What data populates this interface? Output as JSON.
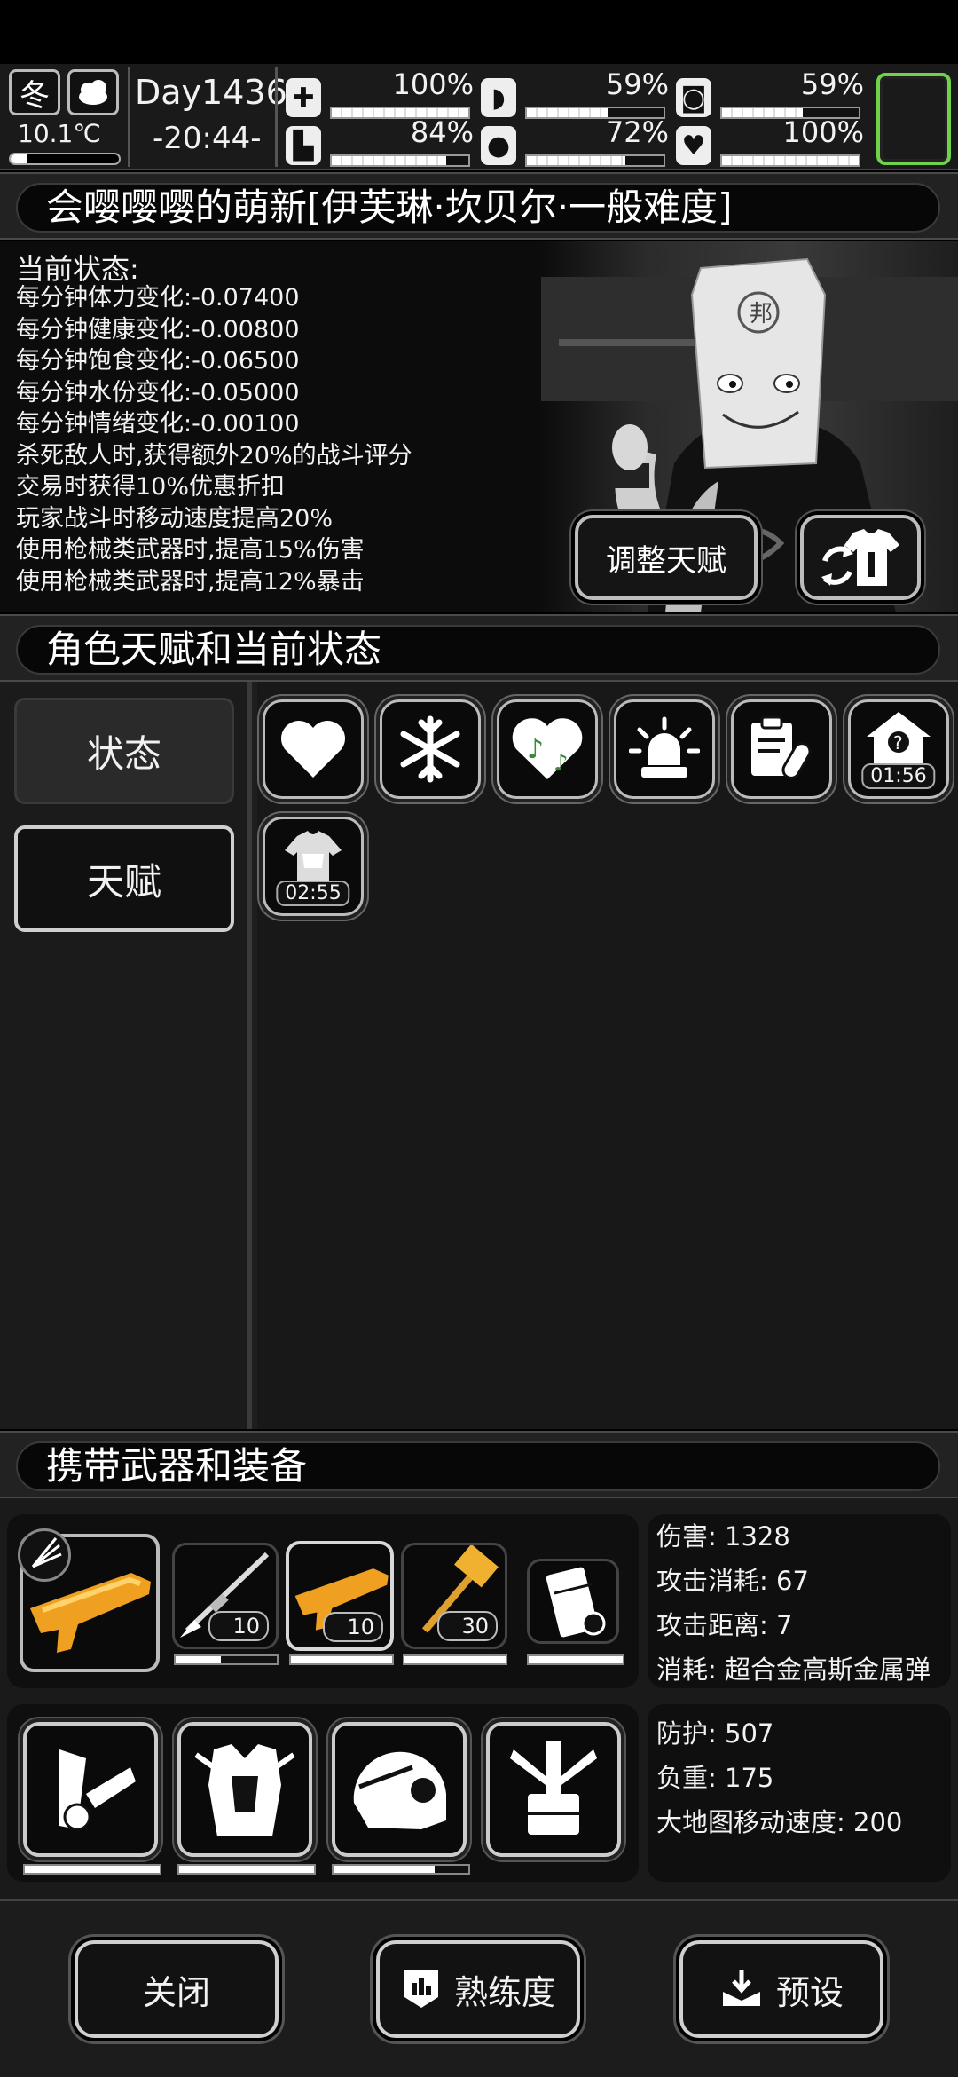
{
  "hud": {
    "season": "冬",
    "temperature": "10.1℃",
    "temperature_level": 0.15,
    "day": "Day1436",
    "time": "-20:44-",
    "stats": [
      {
        "icon": "medkit-icon",
        "value": "100%",
        "level": 1.0
      },
      {
        "icon": "stomach-icon",
        "value": "59%",
        "level": 0.59
      },
      {
        "icon": "bladder-icon",
        "value": "59%",
        "level": 0.59
      },
      {
        "icon": "boot-icon",
        "value": "84%",
        "level": 0.84
      },
      {
        "icon": "water-drop-icon",
        "value": "72%",
        "level": 0.72
      },
      {
        "icon": "heart-icon",
        "value": "100%",
        "level": 1.0
      }
    ]
  },
  "character": {
    "title": "会嘤嘤嘤的萌新[伊芙琳·坎贝尔·一般难度]",
    "status_title": "当前状态:",
    "status_lines": [
      "每分钟体力变化:-0.07400",
      "每分钟健康变化:-0.00800",
      "每分钟饱食变化:-0.06500",
      "每分钟水份变化:-0.05000",
      "每分钟情绪变化:-0.00100",
      "杀死敌人时,获得额外20%的战斗评分",
      "交易时获得10%优惠折扣",
      "玩家战斗时移动速度提高20%",
      "使用枪械类武器时,提高15%伤害",
      "使用枪械类武器时,提高12%暴击"
    ],
    "adjust_talent_label": "调整天赋",
    "bag_face_text": "邦"
  },
  "talent_section": {
    "title": "角色天赋和当前状态",
    "tab_status": "状态",
    "tab_talent": "天赋",
    "status_icons": [
      {
        "icon": "heart-icon",
        "timer": ""
      },
      {
        "icon": "snowflake-icon",
        "timer": ""
      },
      {
        "icon": "music-heart-icon",
        "timer": ""
      },
      {
        "icon": "alarm-light-icon",
        "timer": ""
      },
      {
        "icon": "prescription-pill-icon",
        "timer": ""
      },
      {
        "icon": "shelter-icon",
        "timer": "01:56"
      },
      {
        "icon": "clothing-icon",
        "timer": "02:55"
      }
    ]
  },
  "equipment": {
    "title": "携带武器和装备",
    "weapons": [
      {
        "icon": "golden-shotgun-icon",
        "count": ""
      },
      {
        "icon": "spear-rifle-icon",
        "count": "10",
        "durability": 0.45
      },
      {
        "icon": "golden-shotgun-icon",
        "count": "10",
        "durability": 1.0
      },
      {
        "icon": "golden-hammer-icon",
        "count": "30",
        "durability": 1.0
      },
      {
        "icon": "fridge-icon",
        "count": "",
        "durability": 1.0
      }
    ],
    "weapon_stats": {
      "damage": "伤害: 1328",
      "attack_cost": "攻击消耗: 67",
      "attack_range": "攻击距离: 7",
      "ammo": "消耗: 超合金高斯金属弹"
    },
    "gear": [
      {
        "icon": "bandolier-icon",
        "durability": 1.0
      },
      {
        "icon": "body-armor-icon",
        "durability": 1.0
      },
      {
        "icon": "helmet-icon",
        "durability": 0.75
      },
      {
        "icon": "exoskeleton-icon",
        "durability": 0
      }
    ],
    "gear_stats": {
      "defense": "防护: 507",
      "weight": "负重: 175",
      "map_speed": "大地图移动速度: 200"
    }
  },
  "bottom": {
    "close_label": "关闭",
    "proficiency_label": "熟练度",
    "preset_label": "预设"
  }
}
